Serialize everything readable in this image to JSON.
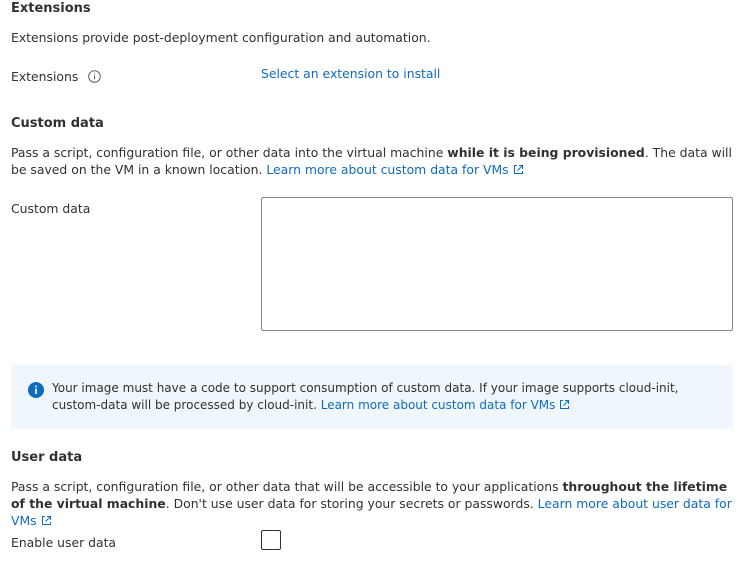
{
  "extensions": {
    "title": "Extensions",
    "description": "Extensions provide post-deployment configuration and automation.",
    "field_label": "Extensions",
    "link": "Select an extension to install"
  },
  "custom_data": {
    "title": "Custom data",
    "desc_prefix": "Pass a script, configuration file, or other data into the virtual machine ",
    "desc_bold": "while it is being provisioned",
    "desc_suffix": ". The data will be saved on the VM in a known location. ",
    "desc_link": "Learn more about custom data for VMs",
    "field_label": "Custom data",
    "field_value": ""
  },
  "info_banner": {
    "text": "Your image must have a code to support consumption of custom data. If your image supports cloud-init, custom-data will be processed by cloud-init. ",
    "link": "Learn more about custom data for VMs"
  },
  "user_data": {
    "title": "User data",
    "desc_prefix": "Pass a script, configuration file, or other data that will be accessible to your applications ",
    "desc_bold": "throughout the lifetime of the virtual machine",
    "desc_suffix": ". Don't use user data for storing your secrets or passwords. ",
    "desc_link": "Learn more about user data for VMs",
    "checkbox_label": "Enable user data",
    "checkbox_checked": false
  },
  "colors": {
    "link": "#0f6cbd",
    "info_icon": "#0f6cbd",
    "banner_bg": "#eff6fc",
    "text": "#323130"
  },
  "icons": {
    "info_tooltip": "info-circle-icon",
    "external_link": "external-link-icon",
    "info_banner": "info-filled-icon"
  }
}
